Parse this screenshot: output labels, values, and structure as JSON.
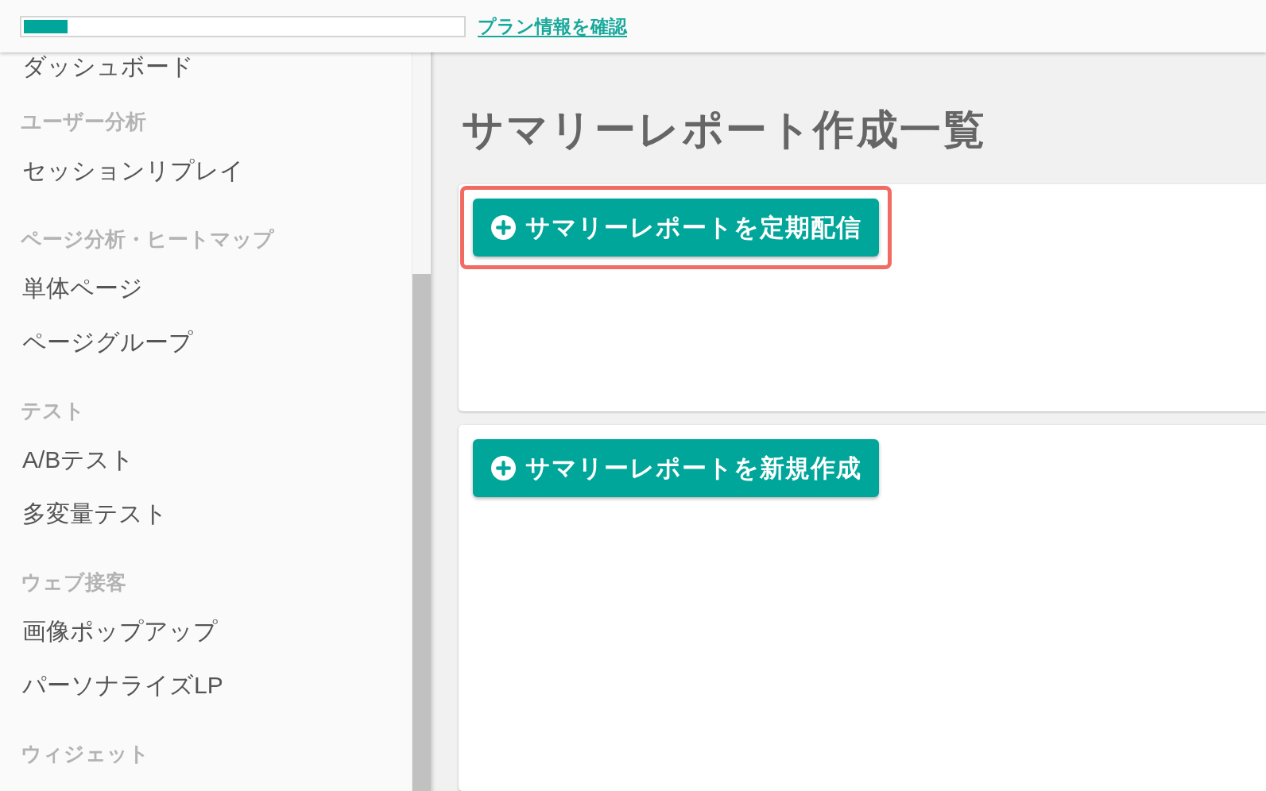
{
  "header": {
    "usage_bar": {
      "level": 0.1
    },
    "link": "プラン情報を確認"
  },
  "sidebar": {
    "entries": [
      {
        "kind": "item",
        "label": "ダッシュボード"
      },
      {
        "kind": "heading",
        "label": "ユーザー分析"
      },
      {
        "kind": "item",
        "label": "セッションリプレイ"
      },
      {
        "kind": "heading",
        "label": "ページ分析・ヒートマップ"
      },
      {
        "kind": "item",
        "label": "単体ページ"
      },
      {
        "kind": "item",
        "label": "ページグループ"
      },
      {
        "kind": "heading",
        "label": "テスト"
      },
      {
        "kind": "item",
        "label": "A/Bテスト"
      },
      {
        "kind": "item",
        "label": "多変量テスト"
      },
      {
        "kind": "heading",
        "label": "ウェブ接客"
      },
      {
        "kind": "item",
        "label": "画像ポップアップ"
      },
      {
        "kind": "item",
        "label": "パーソナライズLP"
      },
      {
        "kind": "heading",
        "label": "ウィジェット"
      }
    ]
  },
  "main": {
    "title": "サマリーレポート作成一覧",
    "cards": [
      {
        "button": {
          "label": "サマリーレポートを定期配信",
          "highlighted": true
        }
      },
      {
        "button": {
          "label": "サマリーレポートを新規作成",
          "highlighted": false
        }
      }
    ]
  }
}
